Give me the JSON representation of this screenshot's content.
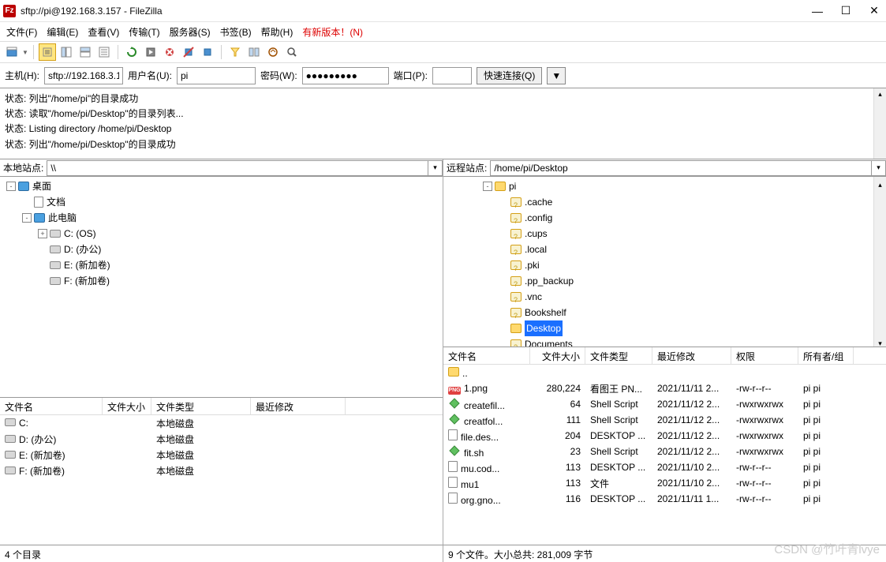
{
  "title": "sftp://pi@192.168.3.157 - FileZilla",
  "menus": {
    "file": "文件(F)",
    "edit": "编辑(E)",
    "view": "查看(V)",
    "transfer": "传输(T)",
    "server": "服务器(S)",
    "bookmarks": "书签(B)",
    "help": "帮助(H)",
    "newver": "有新版本！(N)"
  },
  "quick": {
    "host_label": "主机(H):",
    "user_label": "用户名(U):",
    "pass_label": "密码(W):",
    "port_label": "端口(P):",
    "host": "sftp://192.168.3.1",
    "user": "pi",
    "pass": "●●●●●●●●●",
    "port": "",
    "connect": "快速连接(Q)",
    "dropdown": "▼"
  },
  "log": [
    "状态: 列出\"/home/pi\"的目录成功",
    "状态: 读取\"/home/pi/Desktop\"的目录列表...",
    "状态: Listing directory /home/pi/Desktop",
    "状态: 列出\"/home/pi/Desktop\"的目录成功"
  ],
  "local": {
    "label": "本地站点:",
    "path": "\\\\",
    "tree": [
      {
        "indent": 0,
        "exp": "-",
        "icon": "desktop",
        "text": "桌面"
      },
      {
        "indent": 1,
        "exp": "",
        "icon": "doc",
        "text": "文档"
      },
      {
        "indent": 1,
        "exp": "-",
        "icon": "desktop",
        "text": "此电脑"
      },
      {
        "indent": 2,
        "exp": "+",
        "icon": "drive",
        "text": "C: (OS)"
      },
      {
        "indent": 2,
        "exp": "",
        "icon": "drive",
        "text": "D: (办公)"
      },
      {
        "indent": 2,
        "exp": "",
        "icon": "drive",
        "text": "E: (新加卷)"
      },
      {
        "indent": 2,
        "exp": "",
        "icon": "drive",
        "text": "F: (新加卷)"
      }
    ],
    "cols": {
      "name": "文件名",
      "size": "文件大小",
      "type": "文件类型",
      "date": "最近修改"
    },
    "files": [
      {
        "name": "C:",
        "type": "本地磁盘"
      },
      {
        "name": "D: (办公)",
        "type": "本地磁盘"
      },
      {
        "name": "E: (新加卷)",
        "type": "本地磁盘"
      },
      {
        "name": "F: (新加卷)",
        "type": "本地磁盘"
      }
    ],
    "status": "4 个目录"
  },
  "remote": {
    "label": "远程站点:",
    "path": "/home/pi/Desktop",
    "tree": [
      {
        "indent": 0,
        "exp": "-",
        "icon": "folder",
        "text": "pi"
      },
      {
        "indent": 1,
        "exp": "",
        "icon": "folder_unk",
        "text": ".cache"
      },
      {
        "indent": 1,
        "exp": "",
        "icon": "folder_unk",
        "text": ".config"
      },
      {
        "indent": 1,
        "exp": "",
        "icon": "folder_unk",
        "text": ".cups"
      },
      {
        "indent": 1,
        "exp": "",
        "icon": "folder_unk",
        "text": ".local"
      },
      {
        "indent": 1,
        "exp": "",
        "icon": "folder_unk",
        "text": ".pki"
      },
      {
        "indent": 1,
        "exp": "",
        "icon": "folder_unk",
        "text": ".pp_backup"
      },
      {
        "indent": 1,
        "exp": "",
        "icon": "folder_unk",
        "text": ".vnc"
      },
      {
        "indent": 1,
        "exp": "",
        "icon": "folder_unk",
        "text": "Bookshelf"
      },
      {
        "indent": 1,
        "exp": "",
        "icon": "folder",
        "text": "Desktop",
        "selected": true
      },
      {
        "indent": 1,
        "exp": "",
        "icon": "folder_unk",
        "text": "Documents"
      }
    ],
    "cols": {
      "name": "文件名",
      "size": "文件大小",
      "type": "文件类型",
      "date": "最近修改",
      "perm": "权限",
      "own": "所有者/组"
    },
    "files": [
      {
        "icon": "folder",
        "name": ".."
      },
      {
        "icon": "png",
        "name": "1.png",
        "size": "280,224",
        "type": "看图王 PN...",
        "date": "2021/11/11 2...",
        "perm": "-rw-r--r--",
        "own": "pi pi"
      },
      {
        "icon": "sh",
        "name": "createfil...",
        "size": "64",
        "type": "Shell Script",
        "date": "2021/11/12 2...",
        "perm": "-rwxrwxrwx",
        "own": "pi pi"
      },
      {
        "icon": "sh",
        "name": "creatfol...",
        "size": "111",
        "type": "Shell Script",
        "date": "2021/11/12 2...",
        "perm": "-rwxrwxrwx",
        "own": "pi pi"
      },
      {
        "icon": "doc",
        "name": "file.des...",
        "size": "204",
        "type": "DESKTOP ...",
        "date": "2021/11/12 2...",
        "perm": "-rwxrwxrwx",
        "own": "pi pi"
      },
      {
        "icon": "sh",
        "name": "fit.sh",
        "size": "23",
        "type": "Shell Script",
        "date": "2021/11/12 2...",
        "perm": "-rwxrwxrwx",
        "own": "pi pi"
      },
      {
        "icon": "doc",
        "name": "mu.cod...",
        "size": "113",
        "type": "DESKTOP ...",
        "date": "2021/11/10 2...",
        "perm": "-rw-r--r--",
        "own": "pi pi"
      },
      {
        "icon": "doc",
        "name": "mu1",
        "size": "113",
        "type": "文件",
        "date": "2021/11/10 2...",
        "perm": "-rw-r--r--",
        "own": "pi pi"
      },
      {
        "icon": "doc",
        "name": "org.gno...",
        "size": "116",
        "type": "DESKTOP ...",
        "date": "2021/11/11 1...",
        "perm": "-rw-r--r--",
        "own": "pi pi"
      }
    ],
    "status": "9 个文件。大小总共: 281,009 字节"
  },
  "watermark": "CSDN @竹叶青lvye",
  "toolbar_icons": [
    "site-manager",
    "sep",
    "toggle-log",
    "toggle-local",
    "toggle-remote",
    "toggle-queue",
    "sep",
    "refresh",
    "process-queue",
    "cancel",
    "disconnect",
    "reconnect",
    "sep",
    "filter",
    "compare",
    "sync-browse",
    "search"
  ]
}
